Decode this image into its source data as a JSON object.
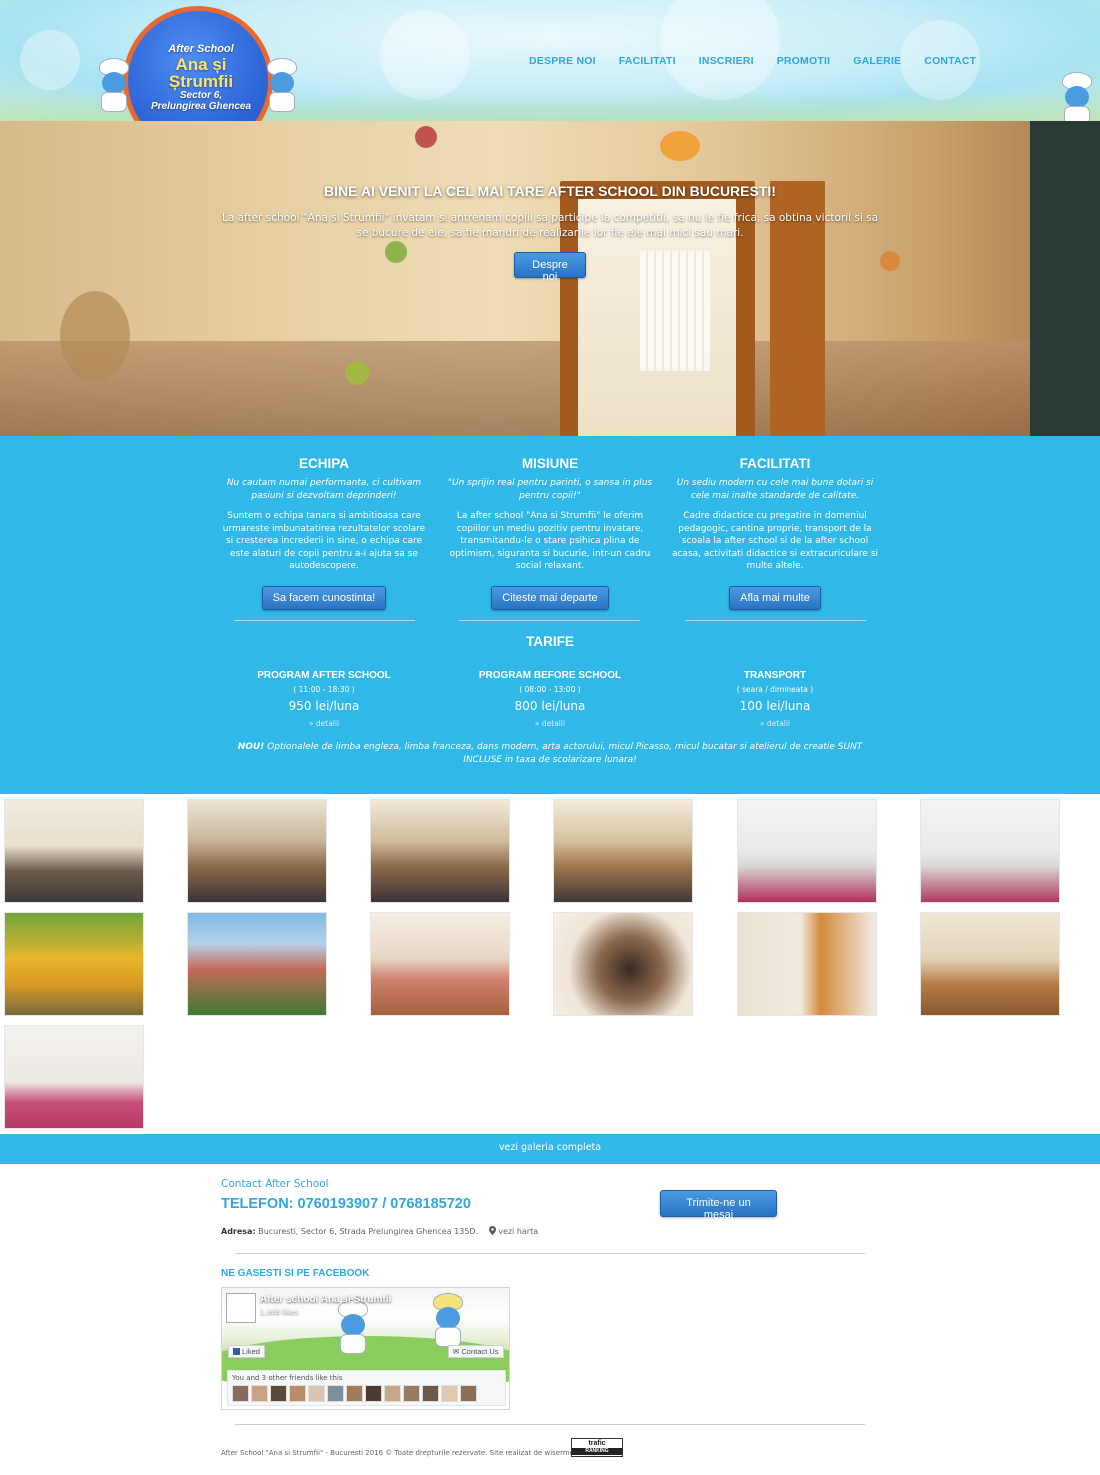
{
  "header": {
    "logo": {
      "line1": "After School",
      "line2": "Ana și",
      "line3": "Ștrumfii",
      "line4": "Sector 6,",
      "line5": "Prelungirea Ghencea"
    },
    "nav": [
      "DESPRE NOI",
      "FACILITATI",
      "INSCRIERI",
      "PROMOTII",
      "GALERIE",
      "CONTACT"
    ]
  },
  "hero": {
    "title": "BINE AI VENIT LA CEL MAI TARE AFTER SCHOOL DIN BUCURESTI!",
    "text": "La after school \"Ana si Strumfii\" invatam si antrenam copiii sa participe la competitii, sa nu le fie frica, sa obtina victorii si sa se bucure de ele, sa fie mandri de realizarile lor fie ele mai mici sau mari.",
    "button": "Despre noi"
  },
  "columns": [
    {
      "title": "ECHIPA",
      "tagline": "Nu cautam numai performanta, ci cultivam pasiuni si dezvoltam deprinderi!",
      "body": "Suntem o echipa tanara si ambitioasa care urmareste imbunatatirea rezultatelor scolare si cresterea increderii in sine, o echipa care este alaturi de copii pentru a-i ajuta sa se autodescopere.",
      "button": "Sa facem cunostinta!"
    },
    {
      "title": "MISIUNE",
      "tagline": "\"Un sprijin real pentru parinti, o sansa in plus pentru copii!\"",
      "body": "La after school \"Ana si Strumfii\" le oferim copiilor un mediu pozitiv pentru invatare, transmitandu-le o stare psihica plina de optimism, siguranta si bucurie, intr-un cadru social relaxant.",
      "button": "Citeste mai departe"
    },
    {
      "title": "FACILITATI",
      "tagline": "Un sediu modern cu cele mai bune dotari si cele mai inalte standarde de calitate.",
      "body": "Cadre didactice cu pregatire in domeniul pedagogic, cantina proprie, transport de la scoala la after school si de la after school acasa, activitati didactice si extracuriculare si multe altele.",
      "button": "Afla mai multe"
    }
  ],
  "tarife": {
    "title": "TARIFE",
    "items": [
      {
        "name": "PROGRAM AFTER SCHOOL",
        "hours": "( 11:00 - 18:30 )",
        "price": "950 lei/luna",
        "link": "» detalii"
      },
      {
        "name": "PROGRAM BEFORE SCHOOL",
        "hours": "( 08:00 - 13:00 )",
        "price": "800 lei/luna",
        "link": "» detalii"
      },
      {
        "name": "TRANSPORT",
        "hours": "( seara / dimineata )",
        "price": "100 lei/luna",
        "link": "» detalii"
      }
    ],
    "note_prefix": "NOU!",
    "note": "Optionalele de limba engleza, limba franceza, dans modern, arta actorului, micul Picasso, micul bucatar si atelierul de creatie SUNT INCLUSE in taxa de scolarizare lunara!"
  },
  "gallery": {
    "link": "vezi galeria completa"
  },
  "contact": {
    "label": "Contact After School",
    "phone": "TELEFON: 0760193907 / 0768185720",
    "address_label": "Adresa:",
    "address": "Bucuresti, Sector 6, Strada Prelungirea Ghencea 135D.",
    "map_link": "vezi harta",
    "message_button": "Trimite-ne un mesaj"
  },
  "facebook": {
    "title": "NE GASESTI SI PE FACEBOOK",
    "page_name": "After school Ana si Strumfii",
    "likes": "1,368 likes",
    "liked": "Liked",
    "contact_us": "Contact Us",
    "friends_text": "You and 3 other friends like this"
  },
  "footer": {
    "text": "After School \"Ana si Strumfii\" - Bucuresti 2016 © Toate drepturile rezervate. Site realizat de wisermedia.ro",
    "badge_top": "trafic",
    "badge_bottom": "RANKING"
  }
}
